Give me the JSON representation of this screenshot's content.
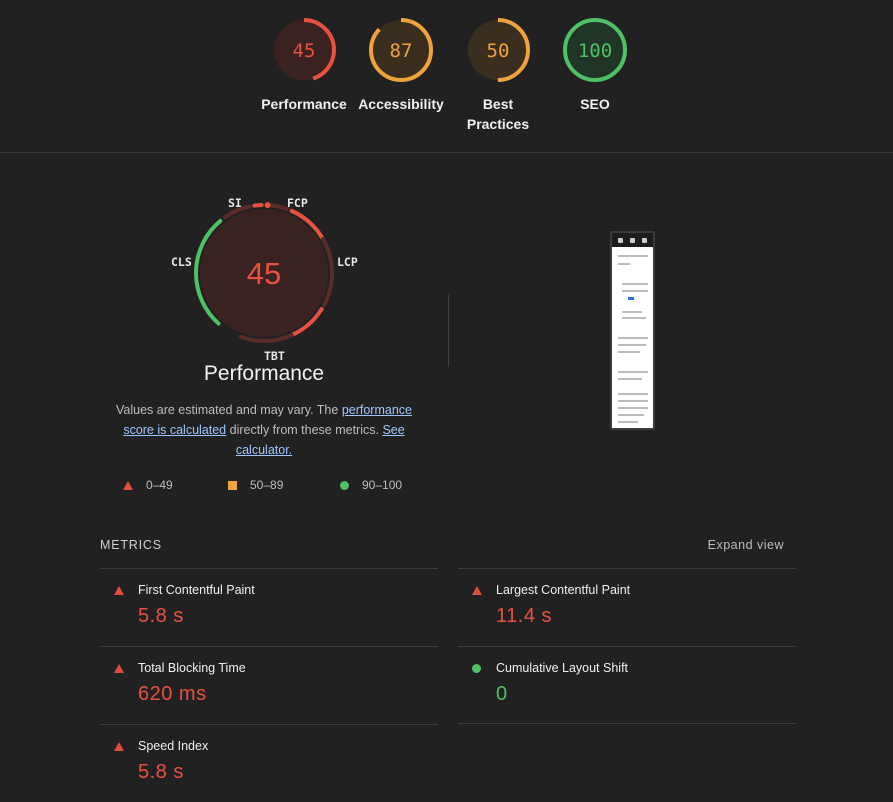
{
  "categories": [
    {
      "label": "Performance",
      "score": 45,
      "fraction": 0.45,
      "color": "#e8513f",
      "bg": "#3a2220"
    },
    {
      "label": "Accessibility",
      "score": 87,
      "fraction": 0.87,
      "color": "#f0a23c",
      "bg": "#3a2f1f"
    },
    {
      "label": "Best Practices",
      "score": 50,
      "fraction": 0.5,
      "color": "#f0a23c",
      "bg": "#3a2f1f"
    },
    {
      "label": "SEO",
      "score": 100,
      "fraction": 1.0,
      "color": "#4ec164",
      "bg": "#213526"
    }
  ],
  "big_gauge": {
    "score": 45,
    "title": "Performance",
    "tags": {
      "si": "SI",
      "fcp": "FCP",
      "lcp": "LCP",
      "tbt": "TBT",
      "cls": "CLS"
    }
  },
  "description": {
    "before": "Values are estimated and may vary. The ",
    "link1": "performance score is calculated",
    "middle": " directly from these metrics. ",
    "link2": "See calculator."
  },
  "legend": [
    {
      "shape": "triangle",
      "label": "0–49",
      "color": "#e04e3b"
    },
    {
      "shape": "square",
      "label": "50–89",
      "color": "#f0a23c"
    },
    {
      "shape": "circle",
      "label": "90–100",
      "color": "#4ec164"
    }
  ],
  "metrics_section": {
    "title": "METRICS",
    "expand_label": "Expand view",
    "items": [
      {
        "name": "First Contentful Paint",
        "value": "5.8 s",
        "status": "fail"
      },
      {
        "name": "Largest Contentful Paint",
        "value": "11.4 s",
        "status": "fail"
      },
      {
        "name": "Total Blocking Time",
        "value": "620 ms",
        "status": "fail"
      },
      {
        "name": "Cumulative Layout Shift",
        "value": "0",
        "status": "pass"
      },
      {
        "name": "Speed Index",
        "value": "5.8 s",
        "status": "fail"
      }
    ]
  }
}
